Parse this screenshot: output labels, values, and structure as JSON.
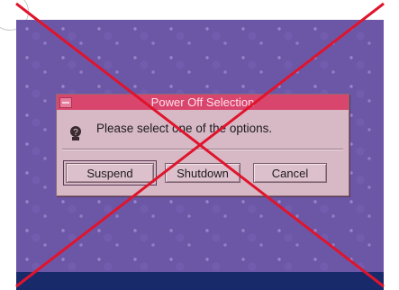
{
  "dialog": {
    "title": "Power Off Selection",
    "message": "Please select one of the options."
  },
  "buttons": {
    "suspend": "Suspend",
    "shutdown": "Shutdown",
    "cancel": "Cancel"
  },
  "colors": {
    "desktop": "#6b57a6",
    "titlebar": "#d8466e",
    "dialog_body": "#d7b9c5",
    "taskbar": "#182a6a",
    "cross": "#e0142c"
  },
  "icons": {
    "window_menu": "window-menu-icon",
    "question": "question-icon"
  }
}
